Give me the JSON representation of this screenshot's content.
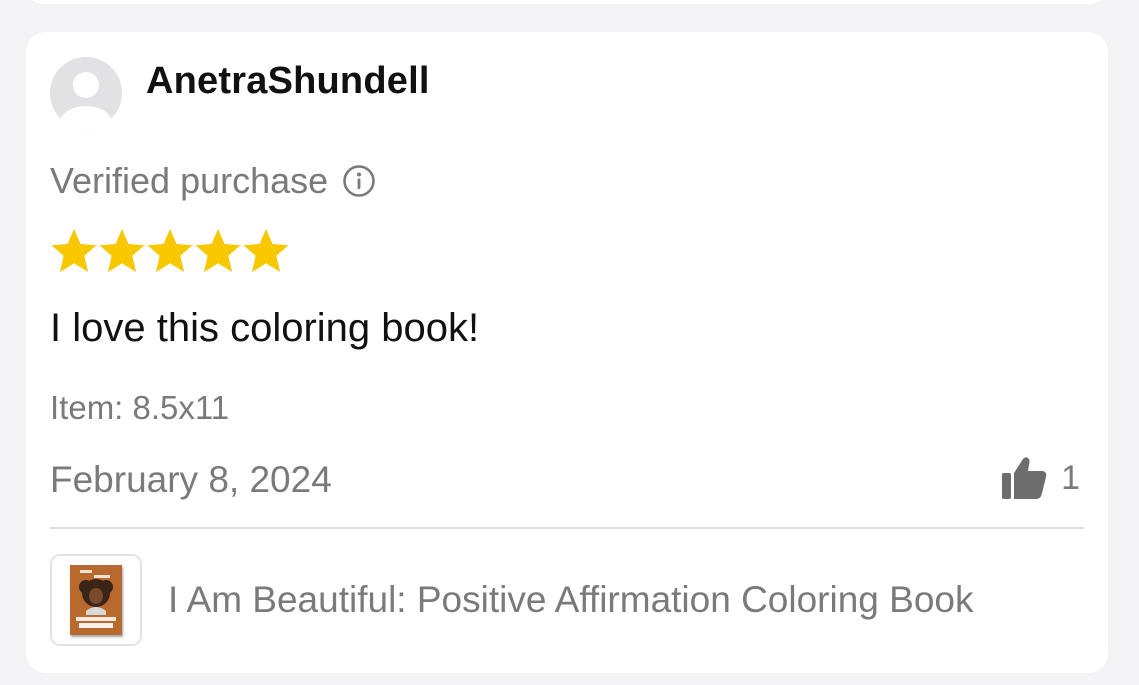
{
  "review": {
    "username": "AnetraShundell",
    "verified_label": "Verified purchase",
    "rating": 5,
    "rating_max": 5,
    "title": "I love this coloring book!",
    "item": "Item: 8.5x11",
    "date": "February 8, 2024",
    "helpful_count": "1"
  },
  "product": {
    "title": "I Am Beautiful: Positive Affirmation Coloring Book"
  },
  "colors": {
    "star": "#f7c800",
    "muted_text": "#7a7a7a",
    "divider": "#dcdce6"
  },
  "icons": {
    "avatar": "default-avatar-icon",
    "info": "info-circle-icon",
    "helpful": "thumbs-up-icon",
    "star": "star-icon"
  }
}
